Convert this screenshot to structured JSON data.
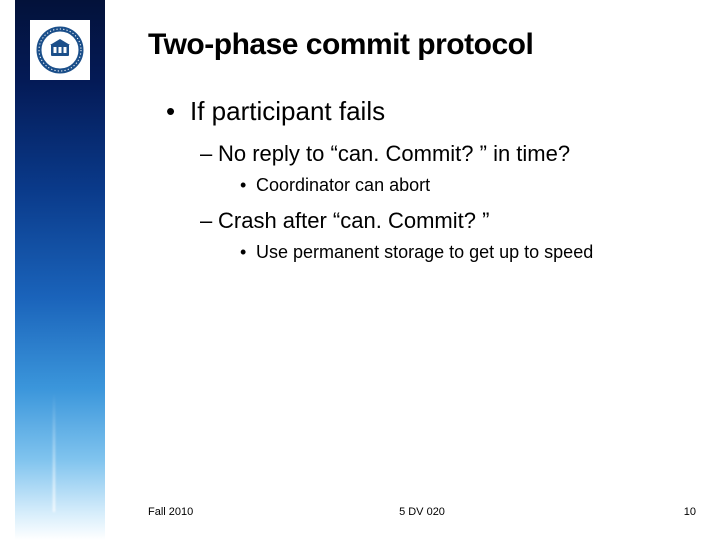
{
  "title": "Two-phase commit protocol",
  "bullets": {
    "l1": "If participant fails",
    "l2a": "No reply to “can. Commit? ” in time?",
    "l3a": "Coordinator can abort",
    "l2b": "Crash after “can. Commit? ”",
    "l3b": "Use permanent storage to get up to speed"
  },
  "footer": {
    "left": "Fall 2010",
    "center": "5 DV 020",
    "right": "10"
  },
  "logo": {
    "alt": "Umeå University seal"
  }
}
